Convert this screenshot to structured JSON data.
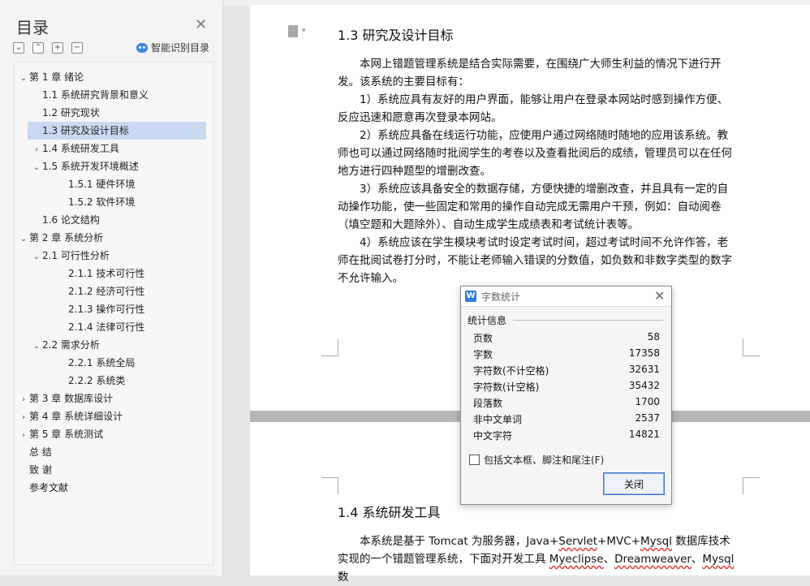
{
  "sidebar": {
    "title": "目录",
    "smart_toc_label": "智能识别目录",
    "toc": [
      {
        "label": "第 1 章  绪论",
        "arrow": "down"
      },
      {
        "label": "1.1 系统研究背景和意义",
        "arrow": ""
      },
      {
        "label": "1.2 研究现状",
        "arrow": ""
      },
      {
        "label": "1.3 研究及设计目标",
        "arrow": "",
        "selected": true
      },
      {
        "label": "1.4 系统研发工具",
        "arrow": "right"
      },
      {
        "label": "1.5 系统开发环境概述",
        "arrow": "down"
      },
      {
        "label": "1.5.1 硬件环境",
        "arrow": ""
      },
      {
        "label": "1.5.2 软件环境",
        "arrow": ""
      },
      {
        "label": "1.6  论文结构",
        "arrow": ""
      },
      {
        "label": "第 2 章  系统分析",
        "arrow": "down"
      },
      {
        "label": "2.1 可行性分析",
        "arrow": "down"
      },
      {
        "label": "2.1.1 技术可行性",
        "arrow": ""
      },
      {
        "label": "2.1.2 经济可行性",
        "arrow": ""
      },
      {
        "label": "2.1.3  操作可行性",
        "arrow": ""
      },
      {
        "label": "2.1.4  法律可行性",
        "arrow": ""
      },
      {
        "label": "2.2  需求分析",
        "arrow": "down"
      },
      {
        "label": "2.2.1 系统全局",
        "arrow": ""
      },
      {
        "label": "2.2.2  系统类",
        "arrow": ""
      },
      {
        "label": "第 3 章  数据库设计",
        "arrow": "right"
      },
      {
        "label": "第 4 章  系统详细设计",
        "arrow": "right"
      },
      {
        "label": "第 5 章  系统测试",
        "arrow": "right"
      },
      {
        "label": "总    结",
        "arrow": ""
      },
      {
        "label": "致    谢",
        "arrow": ""
      },
      {
        "label": "参考文献",
        "arrow": ""
      }
    ]
  },
  "document": {
    "section1_heading": "1.3 研究及设计目标",
    "section1_paragraphs": [
      "本网上错题管理系统是结合实际需要，在围绕广大师生利益的情况下进行开发。该系统的主要目标有：",
      "1）系统应具有友好的用户界面，能够让用户在登录本网站时感到操作方便、反应迅速和愿意再次登录本网站。",
      "2）系统应具备在线运行功能，应使用户通过网络随时随地的应用该系统。教师也可以通过网络随时批阅学生的考卷以及查看批阅后的成绩，管理员可以在任何地方进行四种题型的增删改查。",
      "3）系统应该具备安全的数据存储，方便快捷的增删改查，并且具有一定的自动操作功能，使一些固定和常用的操作自动完成无需用户干预，例如：自动阅卷（填空题和大题除外）、自动生成学生成绩表和考试统计表等。",
      "4）系统应该在学生模块考试时设定考试时间，超过考试时间不允许作答，老师在批阅试卷打分时，不能让老师输入错误的分数值，如负数和非数字类型的数字不允许输入。"
    ],
    "section2_heading": "1.4 系统研发工具",
    "section2_text_a": "本系统是基于 Tomcat 为服务器，Java+",
    "section2_servlet": "Servlet",
    "section2_text_b": "+MVC+",
    "section2_mysql": "Mysql",
    "section2_text_c": " 数据库技术实现的一个错题管理系统，下面对开发工具 ",
    "section2_myeclipse": "Myeclipse",
    "section2_sep1": "、",
    "section2_dreamweaver": "Dreamweaver",
    "section2_sep2": "、",
    "section2_mysql2": "Mysql",
    "section2_text_d": " 数"
  },
  "dialog": {
    "title": "字数统计",
    "logo": "W",
    "section": "统计信息",
    "stats": [
      {
        "label": "页数",
        "value": "58"
      },
      {
        "label": "字数",
        "value": "17358"
      },
      {
        "label": "字符数(不计空格)",
        "value": "32631"
      },
      {
        "label": "字符数(计空格)",
        "value": "35432"
      },
      {
        "label": "段落数",
        "value": "1700"
      },
      {
        "label": "非中文单词",
        "value": "2537"
      },
      {
        "label": "中文字符",
        "value": "14821"
      }
    ],
    "checkbox_label": "包括文本框、脚注和尾注(F)",
    "ok_label": "关闭"
  }
}
